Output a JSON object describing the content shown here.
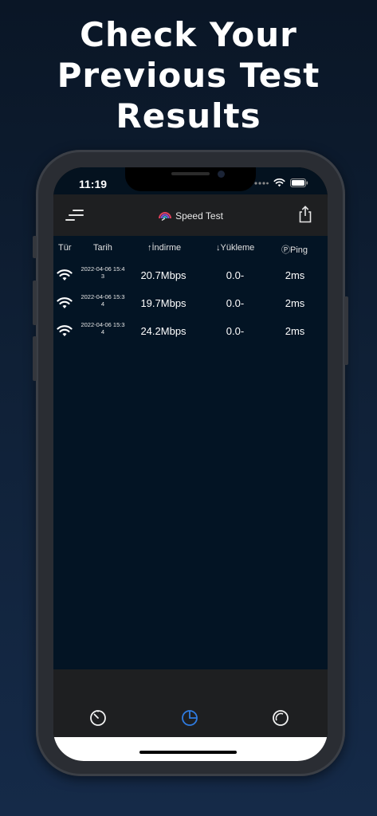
{
  "headline": {
    "line1": "Check Your",
    "line2": "Previous Test",
    "line3": "Results"
  },
  "status_bar": {
    "time": "11:19",
    "icons": [
      "signal-dots-icon",
      "wifi-icon",
      "battery-icon"
    ]
  },
  "nav": {
    "title": "Speed Test",
    "left_icon": "menu-icon",
    "right_icon": "share-icon"
  },
  "table": {
    "headers": {
      "type": "Tür",
      "date": "Tarih",
      "download": "İndirme",
      "upload": "Yükleme",
      "ping": "Ping"
    },
    "rows": [
      {
        "type_icon": "wifi-icon",
        "date_line1": "2022-04-06 15:4",
        "date_line2": "3",
        "download": "20.7Mbps",
        "upload": "0.0-",
        "ping": "2ms"
      },
      {
        "type_icon": "wifi-icon",
        "date_line1": "2022-04-06 15:3",
        "date_line2": "4",
        "download": "19.7Mbps",
        "upload": "0.0-",
        "ping": "2ms"
      },
      {
        "type_icon": "wifi-icon",
        "date_line1": "2022-04-06 15:3",
        "date_line2": "4",
        "download": "24.2Mbps",
        "upload": "0.0-",
        "ping": "2ms"
      }
    ]
  },
  "tab_bar": {
    "tabs": [
      {
        "icon": "speedometer-icon",
        "active": false
      },
      {
        "icon": "history-pie-icon",
        "active": true
      },
      {
        "icon": "settings-ring-icon",
        "active": false
      }
    ]
  },
  "colors": {
    "accent": "#2f7be0",
    "content_bg": "#031424",
    "bar_bg": "#1e1f21"
  }
}
